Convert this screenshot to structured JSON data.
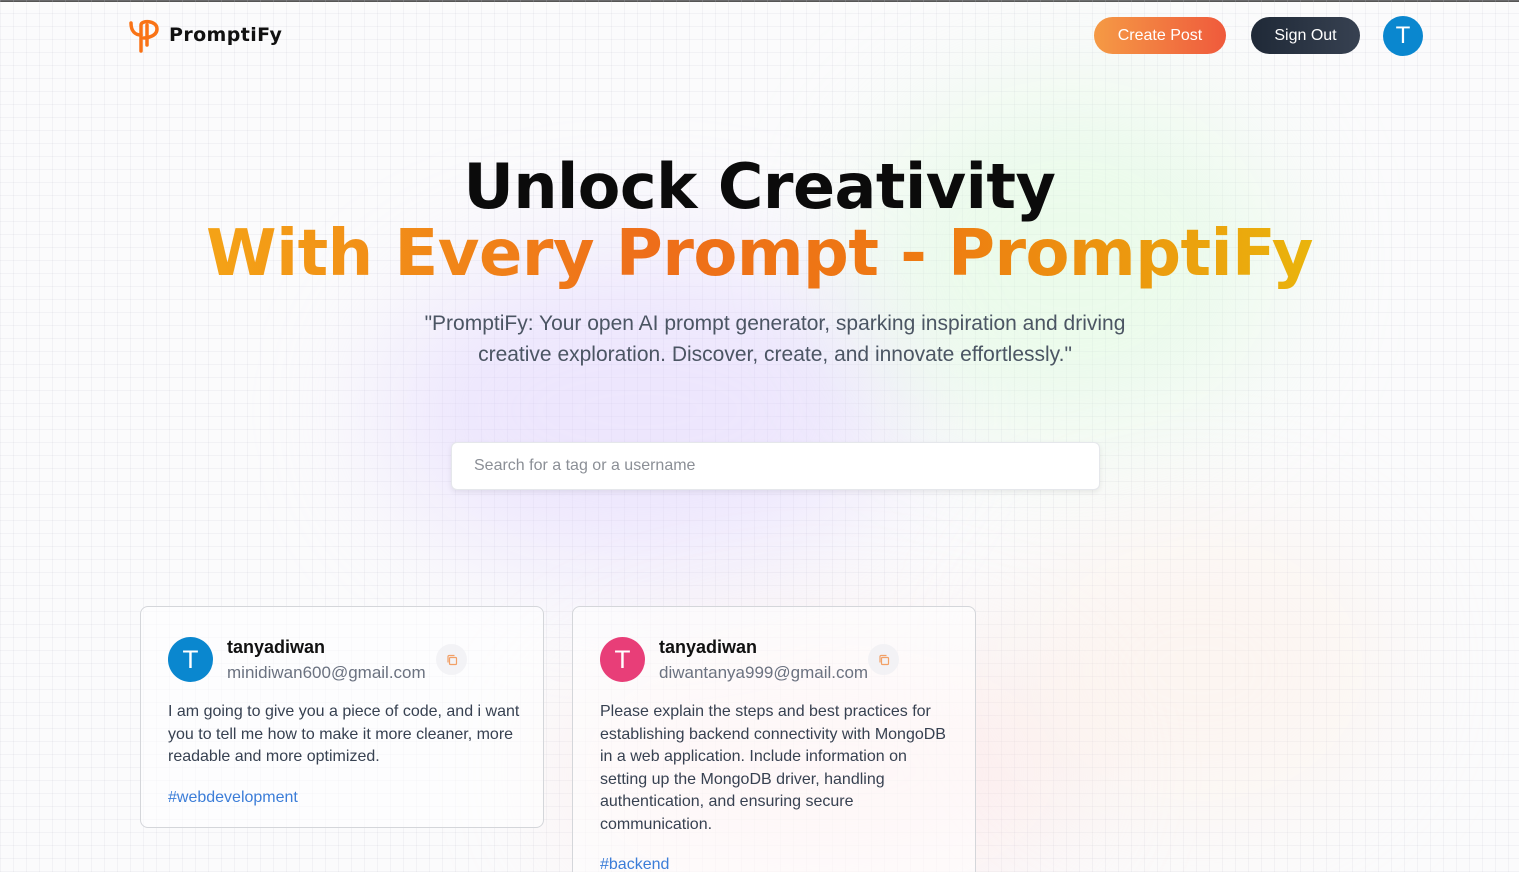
{
  "navbar": {
    "brand": "PromptiFy",
    "create_post_label": "Create Post",
    "sign_out_label": "Sign Out",
    "user_initial": "T",
    "colors": {
      "accent_orange": "#f59a45",
      "accent_red": "#ef5a3c",
      "dark": "#1f2937",
      "avatar_blue": "#0a87cf"
    }
  },
  "hero": {
    "title_line1": "Unlock Creativity",
    "title_line2": "With Every Prompt - PromptiFy",
    "description": "\"PromptiFy: Your open AI prompt generator, sparking inspiration and driving creative exploration. Discover, create, and innovate effortlessly.\""
  },
  "search": {
    "placeholder": "Search for a tag or a username",
    "value": ""
  },
  "posts": [
    {
      "initial": "T",
      "avatar_color": "#0a87cf",
      "username": "tanyadiwan",
      "email": "minidiwan600@gmail.com",
      "prompt": "I am going to give you a piece of code, and i want you to tell me how to make it more cleaner, more readable and more optimized.",
      "tag": "#webdevelopment",
      "copy_icon": "copy-icon"
    },
    {
      "initial": "T",
      "avatar_color": "#e83e78",
      "username": "tanyadiwan",
      "email": "diwantanya999@gmail.com",
      "prompt": "Please explain the steps and best practices for establishing backend connectivity with MongoDB in a web application. Include information on setting up the MongoDB driver, handling authentication, and ensuring secure communication.",
      "tag": "#backend",
      "copy_icon": "copy-icon"
    }
  ]
}
